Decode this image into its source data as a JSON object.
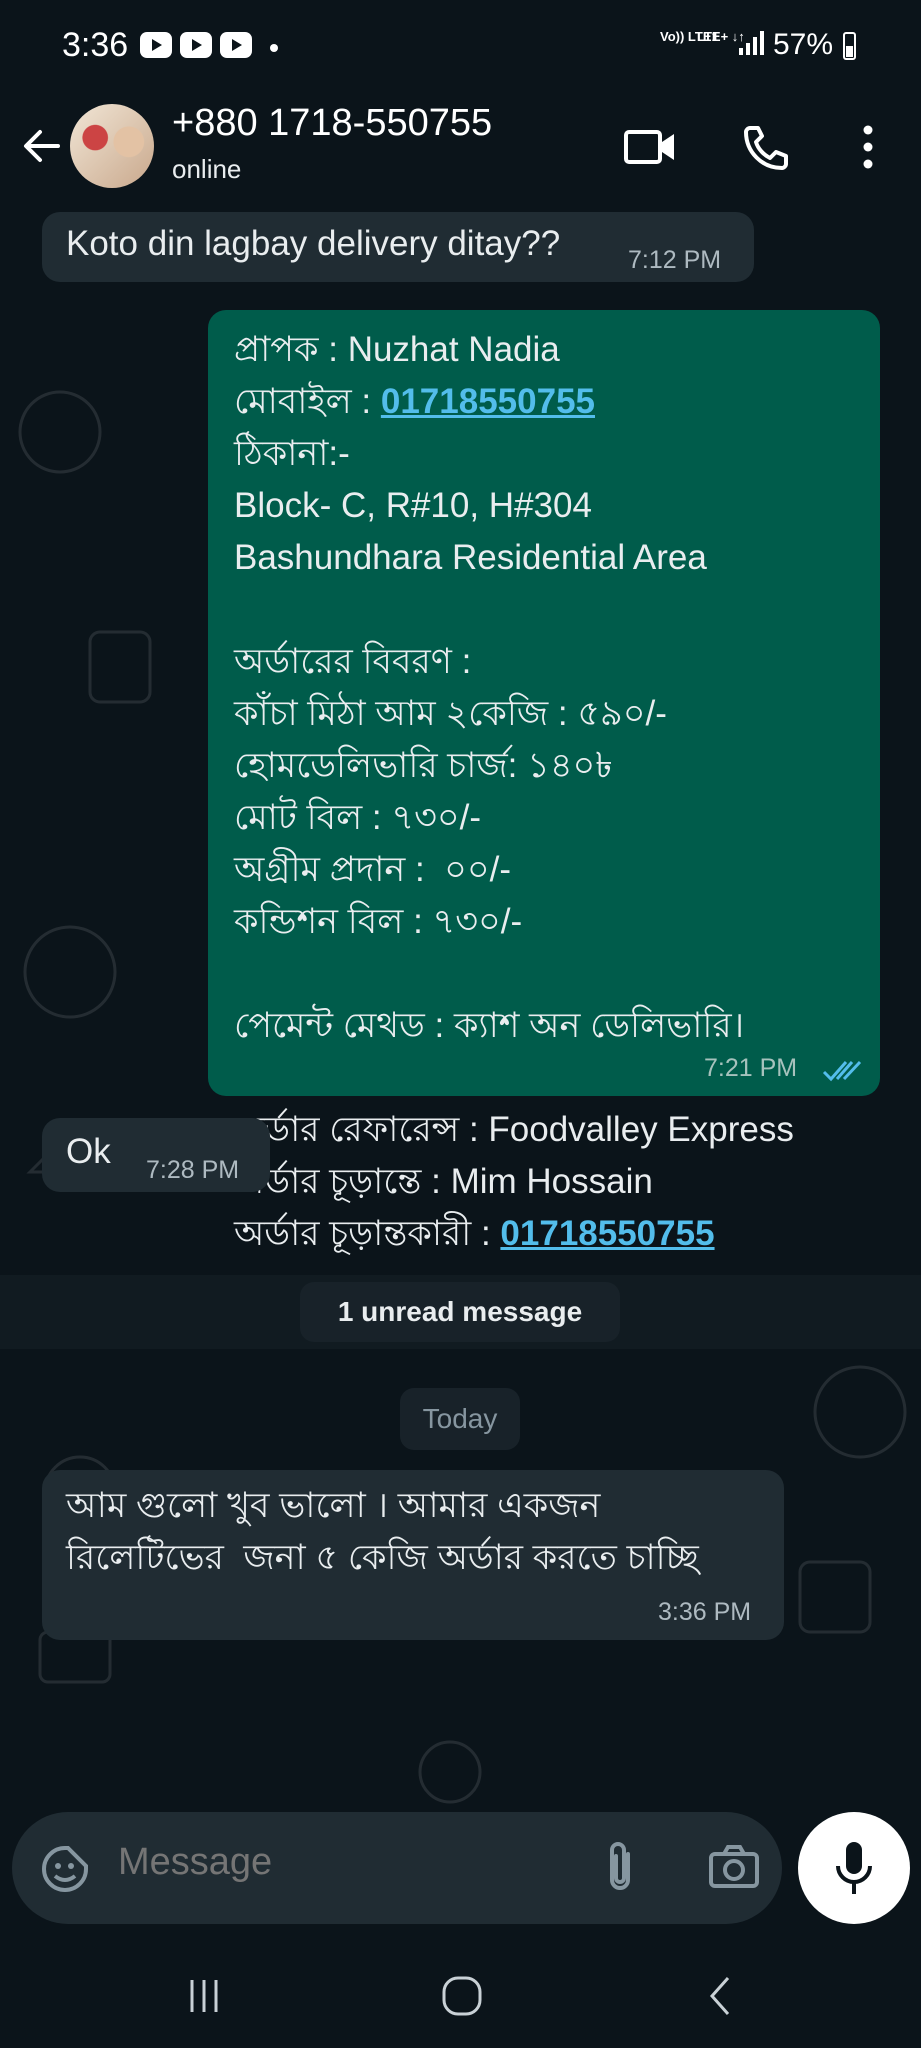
{
  "status_bar": {
    "time": "3:36",
    "network_volte": "Vo)) LTE1",
    "network_lte": "LTE+ ↓↑",
    "battery": "57%"
  },
  "header": {
    "contact_name": "+880 1718-550755",
    "contact_status": "online"
  },
  "messages": {
    "m1": {
      "text": "Koto din lagbay delivery ditay??",
      "time": "7:12 PM"
    },
    "m2": {
      "line1": "প্রাপক : Nuzhat Nadia",
      "mobile_label": "মোবাইল : ",
      "mobile_link": "01718550755",
      "line3": "ঠিকানা:-",
      "line4": "Block- C, R#10, H#304",
      "line5": "Bashundhara Residential Area",
      "line6": "অর্ডারের বিবরণ :",
      "line7": "কাঁচা মিঠা আম ২কেজি : ৫৯০/-",
      "line8": "হোমডেলিভারি চার্জ: ১৪০৳",
      "line9": "মোট বিল : ৭৩০/-",
      "line10": "অগ্রীম প্রদান :  ০০/-",
      "line11": "কন্ডিশন বিল : ৭৩০/-",
      "line12": "পেমেন্ট মেথড : ক্যাশ অন ডেলিভারি।",
      "line13": "অর্ডার রেফারেন্স : Foodvalley Express",
      "line14": "অর্ডার চূড়ান্তে : Mim Hossain",
      "confirmer_label": "অর্ডার চূড়ান্তকারী : ",
      "confirmer_link": "01718550755",
      "time": "7:21 PM"
    },
    "m3": {
      "text": "Ok",
      "time": "7:28 PM"
    },
    "unread_label": "1 unread message",
    "date_label": "Today",
    "m4": {
      "line1": "আম গুলো খুব ভালো । আমার একজন",
      "line2": "রিলেটিভের  জনা ৫ কেজি অর্ডার করতে চাচ্ছি",
      "time": "3:36 PM"
    }
  },
  "composer": {
    "placeholder": "Message"
  },
  "icons": {
    "back": "arrow-left-icon",
    "video": "video-camera-icon",
    "call": "phone-icon",
    "menu": "more-vertical-icon",
    "emoji": "sticker-icon",
    "attach": "paperclip-icon",
    "camera": "camera-icon",
    "mic": "microphone-icon",
    "read": "double-check-icon"
  },
  "colors": {
    "background": "#0b141a",
    "incoming_bubble": "#202c33",
    "outgoing_bubble": "#005c4b",
    "link": "#53bdeb",
    "read_tick": "#53bdeb"
  }
}
